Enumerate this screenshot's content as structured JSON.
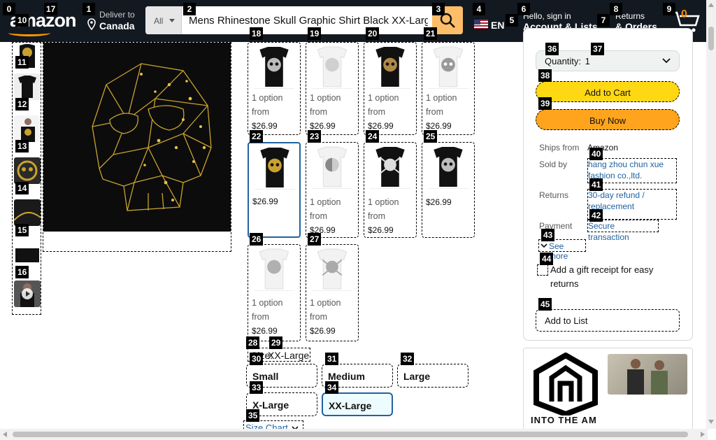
{
  "header": {
    "logo_text": "amazon",
    "deliver_line1": "Deliver to",
    "deliver_line2": "Canada",
    "search_category": "All",
    "search_value": "Mens Rhinestone Skull Graphic Shirt Black XX-Large",
    "lang": "EN",
    "account_line1": "Hello, sign in",
    "account_line2": "Account & Lists",
    "orders_line1": "Returns",
    "orders_line2": "& Orders",
    "cart_count": "0"
  },
  "tiles": [
    {
      "option": "1 option",
      "from": "from",
      "price": "$26.99"
    },
    {
      "option": "1 option",
      "from": "from",
      "price": "$26.99"
    },
    {
      "option": "1 option",
      "from": "from",
      "price": "$26.99"
    },
    {
      "option": "1 option",
      "from": "from",
      "price": "$26.99"
    },
    {
      "option": "",
      "from": "",
      "price": "$26.99"
    },
    {
      "option": "1 option",
      "from": "from",
      "price": "$26.99"
    },
    {
      "option": "1 option",
      "from": "from",
      "price": "$26.99"
    },
    {
      "option": "",
      "from": "",
      "price": "$26.99"
    },
    {
      "option": "1 option",
      "from": "from",
      "price": "$26.99"
    },
    {
      "option": "1 option",
      "from": "from",
      "price": "$26.99"
    }
  ],
  "size": {
    "label": "Size:",
    "selected": "XX-Large",
    "options": [
      "Small",
      "Medium",
      "Large",
      "X-Large",
      "XX-Large"
    ],
    "chart_link": "Size Chart"
  },
  "buybox": {
    "quantity_label": "Quantity:",
    "quantity_value": "1",
    "add_to_cart": "Add to Cart",
    "buy_now": "Buy Now",
    "ships_from_label": "Ships from",
    "ships_from_value": "Amazon",
    "sold_by_label": "Sold by",
    "sold_by_value": "hang zhou chun xue fashion co.,ltd.",
    "returns_label": "Returns",
    "returns_value": "30-day refund / replacement",
    "payment_label": "Payment",
    "payment_value": "Secure transaction",
    "see_more": "See more",
    "gift_receipt": "Add a gift receipt for easy returns",
    "add_to_list": "Add to List"
  },
  "ad": {
    "brand": "INTO THE AM"
  },
  "colors": {
    "header_bg": "#131921",
    "search_button": "#febd69",
    "add_to_cart": "#ffd814",
    "buy_now": "#ffa41c",
    "link": "#2162a1"
  }
}
